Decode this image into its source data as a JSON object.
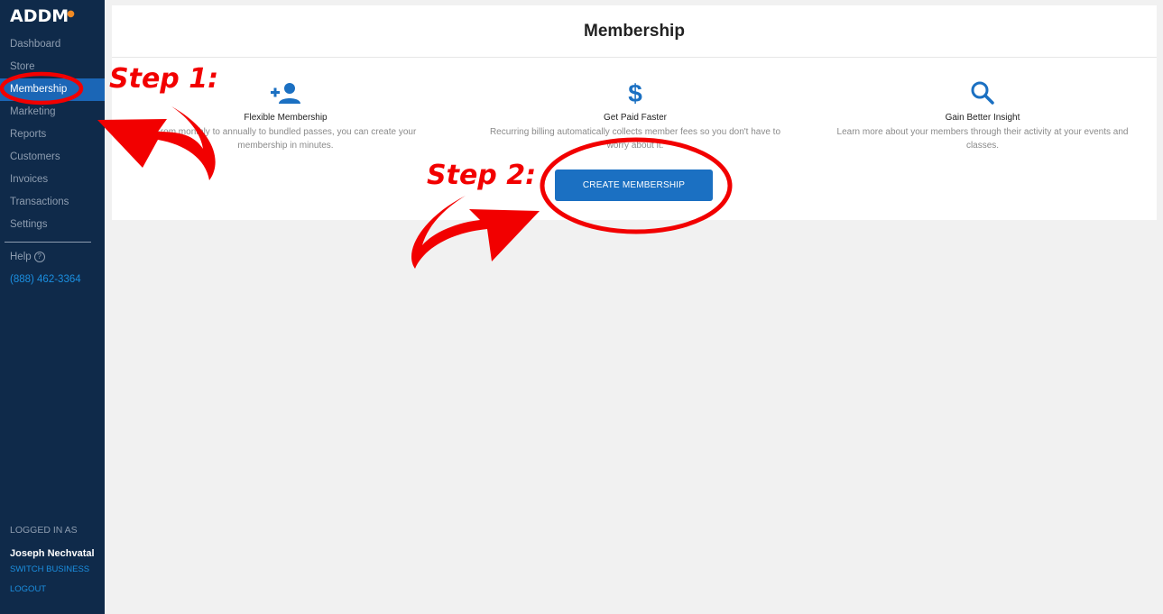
{
  "sidebar": {
    "logo": "ADDM",
    "items": [
      {
        "label": "Dashboard"
      },
      {
        "label": "Store"
      },
      {
        "label": "Membership",
        "active": true
      },
      {
        "label": "Marketing"
      },
      {
        "label": "Reports"
      },
      {
        "label": "Customers"
      },
      {
        "label": "Invoices"
      },
      {
        "label": "Transactions"
      },
      {
        "label": "Settings"
      }
    ],
    "help_label": "Help",
    "phone": "(888) 462-3364",
    "logged_in_label": "LOGGED IN AS",
    "user_name": "Joseph Nechvatal",
    "switch_business": "SWITCH BUSINESS",
    "logout": "LOGOUT"
  },
  "main": {
    "title": "Membership",
    "features": [
      {
        "icon": "add-person-icon",
        "title": "Flexible Membership",
        "description": "From monthly to annually to bundled passes, you can create your membership in minutes."
      },
      {
        "icon": "dollar-icon",
        "title": "Get Paid Faster",
        "description": "Recurring billing automatically collects member fees so you don't have to worry about it."
      },
      {
        "icon": "search-icon",
        "title": "Gain Better Insight",
        "description": "Learn more about your members through their activity at your events and classes."
      }
    ],
    "create_button": "CREATE MEMBERSHIP"
  },
  "annotations": {
    "step1": "Step 1:",
    "step2": "Step 2:",
    "color": "#f20000"
  },
  "colors": {
    "sidebar_bg": "#0f2a4a",
    "accent": "#1b66b6",
    "button": "#1b70c2"
  }
}
